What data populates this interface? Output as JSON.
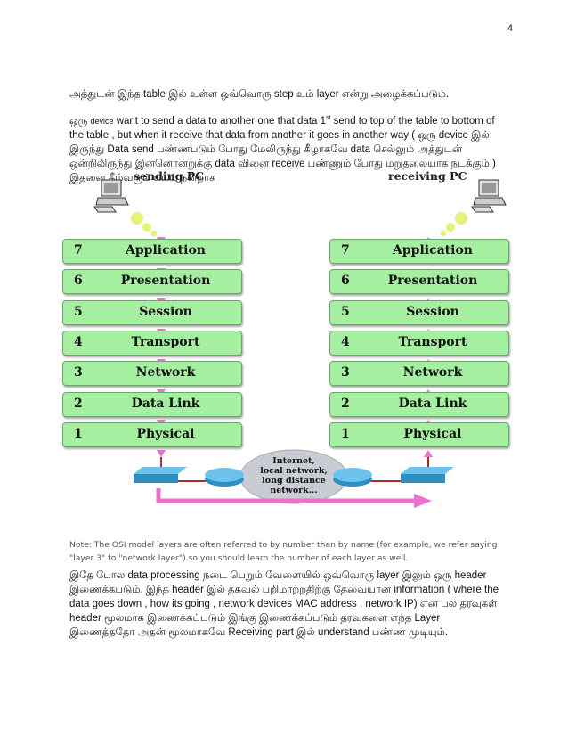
{
  "page_number": "4",
  "paragraph1": "அத்துடன் இந்த table இல் உள்ள ஒவ்வொரு step உம் layer என்று அழைக்கப்படும்.",
  "paragraph2": {
    "prefix": "ஒரு",
    "small_word": "device",
    "text_a": " want to send a data to another one that data 1",
    "sup": "st",
    "text_b": " send to top of the table to bottom of the table , but when it receive that data from another it goes in another way ( ஒரு device இல் இருந்து Data send பண்ணபடும் போது மேலிருந்து கீழாகவே data செல்லும் அத்துடன் ஒன்றிலிருந்து இன்னொன்றுக்கு data வினை receive பண்ணும் போது மறுதலையாக நடக்கும்.) இதனை கீழ்வரும் படம் நன்றாக"
  },
  "diagram": {
    "sending_label": "sending PC",
    "receiving_label": "receiving PC",
    "layers": [
      {
        "num": "7",
        "name": "Application"
      },
      {
        "num": "6",
        "name": "Presentation"
      },
      {
        "num": "5",
        "name": "Session"
      },
      {
        "num": "4",
        "name": "Transport"
      },
      {
        "num": "3",
        "name": "Network"
      },
      {
        "num": "2",
        "name": "Data Link"
      },
      {
        "num": "1",
        "name": "Physical"
      }
    ],
    "cloud_lines": [
      "Internet,",
      "local network,",
      "long distance",
      "network..."
    ],
    "colors": {
      "layer_fill": "#a5f0a0",
      "arrow": "#ee6fd0",
      "link": "#b02a2a",
      "device": "#3a9fd0"
    }
  },
  "note": "Note: The OSI model layers are often referred to by number than by name (for example, we refer saying \"layer 3\" to \"network layer\") so you should learn the number of each layer as well.",
  "paragraph3": "இதே போல data processing நடை பெறும் வேளையில் ஒவ்வொரு layer இலும் ஒரு header இணைக்கபடும். இந்த header இல் தகவல் பறிமாற்றதிற்கு தேவையான information ( where the data goes down , how its going , network devices MAC address , network IP) என பல தரவுகள் header மூலமாக இணைக்கப்படும் இங்கு இணைக்கப்படும் தரவுகளை எந்த Layer இணைத்ததோ அதன் மூலமாகவே Receiving part இல் understand பண்ண முடியும்."
}
